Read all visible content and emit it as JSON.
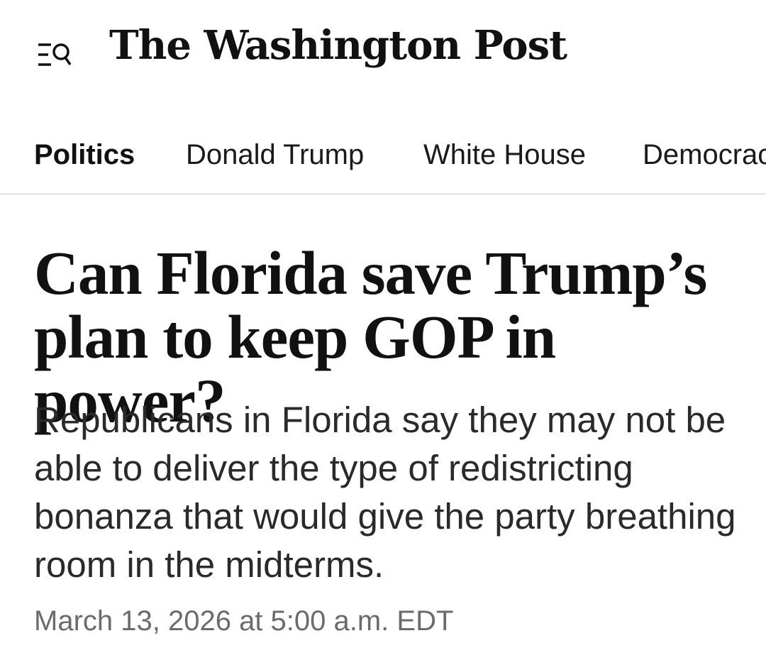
{
  "header": {
    "logo_text": "The Washington Post",
    "menu_icon": "menu-search-icon"
  },
  "nav": {
    "items": [
      {
        "label": "Politics",
        "active": true
      },
      {
        "label": "Donald Trump",
        "active": false
      },
      {
        "label": "White House",
        "active": false
      },
      {
        "label": "Democracy",
        "active": false
      }
    ]
  },
  "article": {
    "headline": "Can Florida save Trump’s plan to keep GOP in power?",
    "dek": "Republicans in Florida say they may not be able to deliver the type of redistricting bonanza that would give the party breathing room in the midterms.",
    "timestamp": "March 13, 2026 at 5:00 a.m. EDT"
  }
}
